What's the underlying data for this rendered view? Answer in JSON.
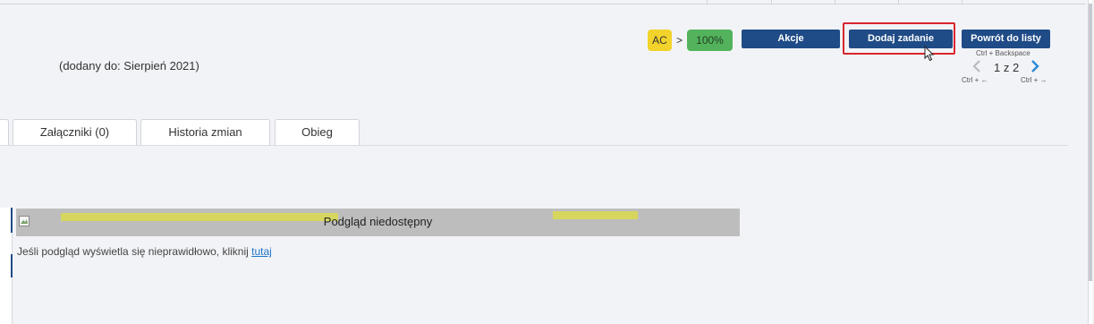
{
  "header": {
    "added_text": "(dodany do: Sierpień 2021)",
    "status_from": "AC",
    "status_arrow": ">",
    "status_to": "100%",
    "actions_label": "Akcje",
    "add_task_label": "Dodaj zadanie",
    "back_label": "Powrót do listy",
    "back_hint": "Ctrl + Backspace",
    "pager_text": "1 z 2",
    "prev_hint": "Ctrl + ←",
    "next_hint": "Ctrl + →"
  },
  "tabs": [
    {
      "label": "Załączniki (0)"
    },
    {
      "label": "Historia zmian"
    },
    {
      "label": "Obieg"
    }
  ],
  "preview": {
    "unavailable_text": "Podgląd niedostępny",
    "note_text": "Jeśli podgląd wyświetla się nieprawidłowo, kliknij",
    "note_link": "tutaj"
  },
  "colors": {
    "primary_button": "#1f4b86",
    "status_yellow": "#f2d32b",
    "status_green": "#53b35c",
    "highlight_red": "#d8252f",
    "link": "#1f74c9"
  },
  "icons": {
    "prev": "chevron-left-icon",
    "next": "chevron-right-icon",
    "cursor": "mouse-pointer-icon",
    "broken_image": "broken-image-icon"
  }
}
